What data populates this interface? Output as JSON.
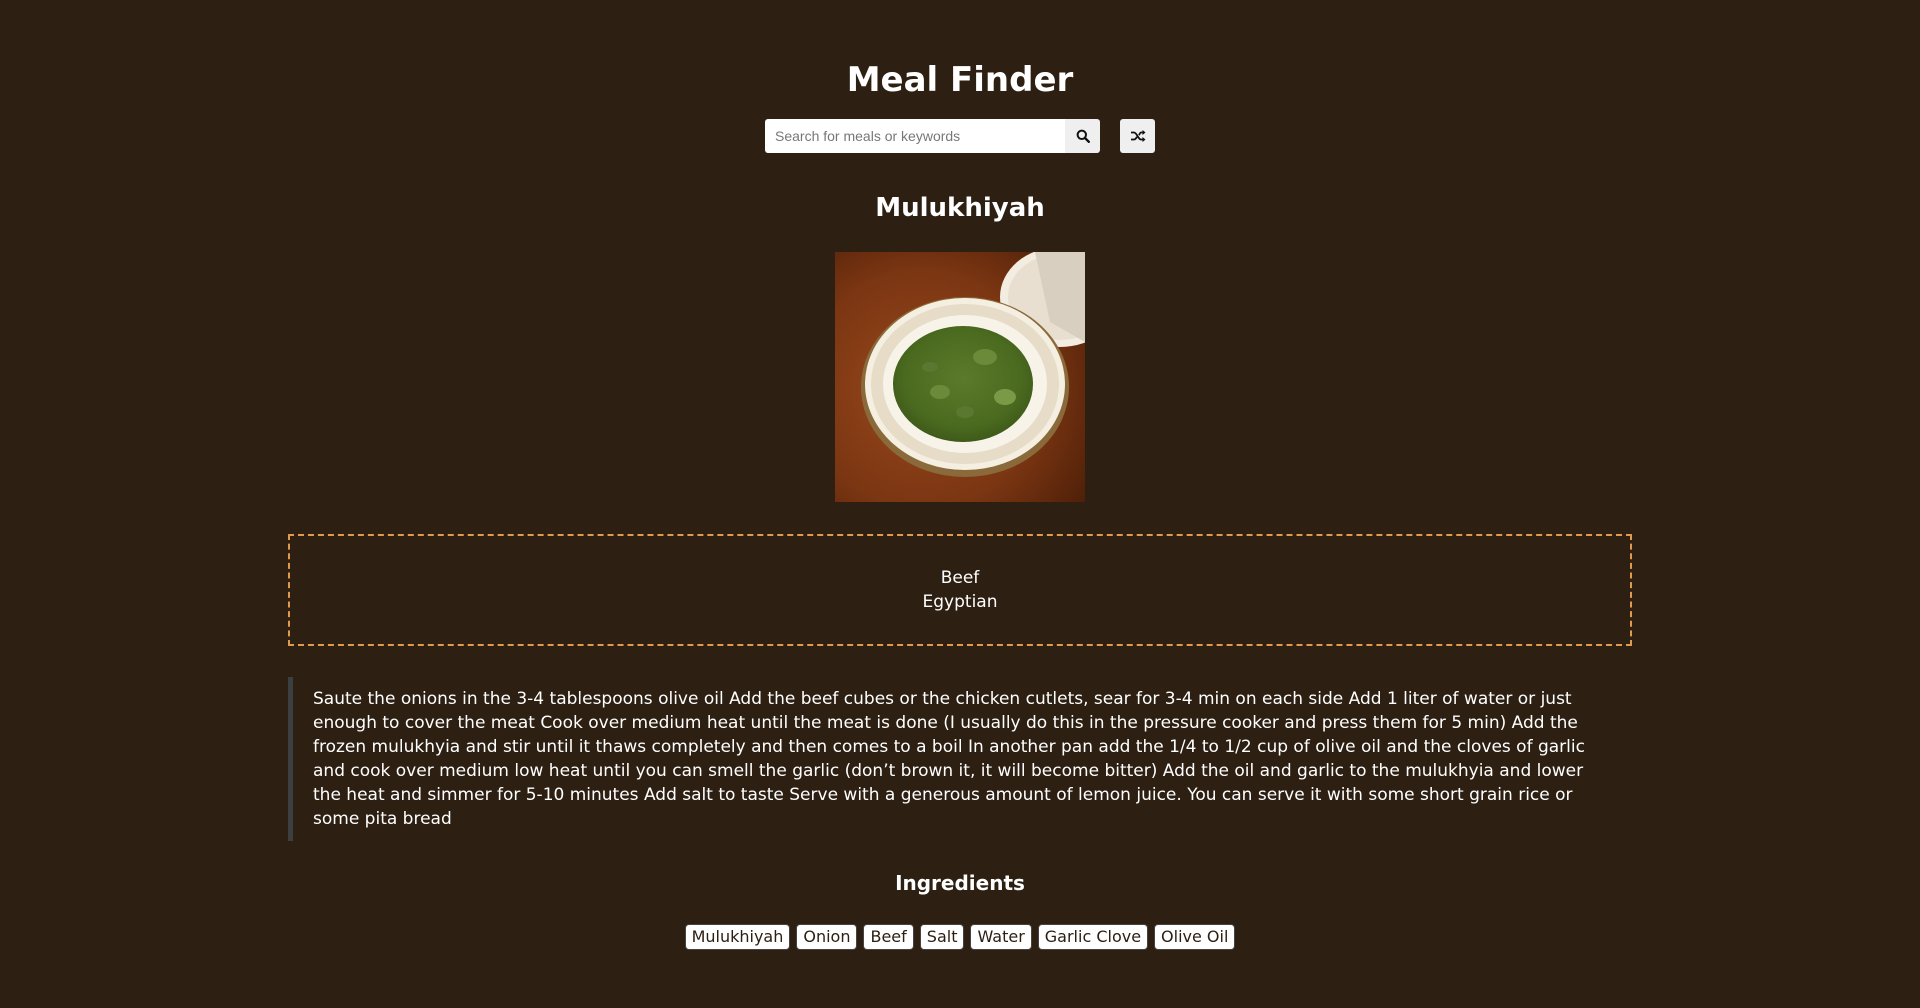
{
  "header": {
    "title": "Meal Finder"
  },
  "search": {
    "placeholder": "Search for meals or keywords",
    "value": "",
    "search_icon": "search-icon",
    "random_icon": "shuffle-icon"
  },
  "meal": {
    "name": "Mulukhiyah",
    "category": "Beef",
    "area": "Egyptian",
    "instructions": "Saute the onions in the 3-4 tablespoons olive oil Add the beef cubes or the chicken cutlets, sear for 3-4 min on each side Add 1 liter of water or just enough to cover the meat Cook over medium heat until the meat is done (I usually do this in the pressure cooker and press them for 5 min) Add the frozen mulukhyia and stir until it thaws completely and then comes to a boil In another pan add the 1/4 to 1/2 cup of olive oil and the cloves of garlic and cook over medium low heat until you can smell the garlic (don’t brown it, it will become bitter) Add the oil and garlic to the mulukhyia and lower the heat and simmer for 5-10 minutes Add salt to taste Serve with a generous amount of lemon juice. You can serve it with some short grain rice or some pita bread",
    "ingredients_heading": "Ingredients",
    "ingredients": [
      "Mulukhiyah",
      "Onion",
      "Beef",
      "Salt",
      "Water",
      "Garlic Clove",
      "Olive Oil"
    ]
  },
  "colors": {
    "background": "#2d2013",
    "border_accent": "#e09a4d",
    "text": "#ffffff"
  }
}
